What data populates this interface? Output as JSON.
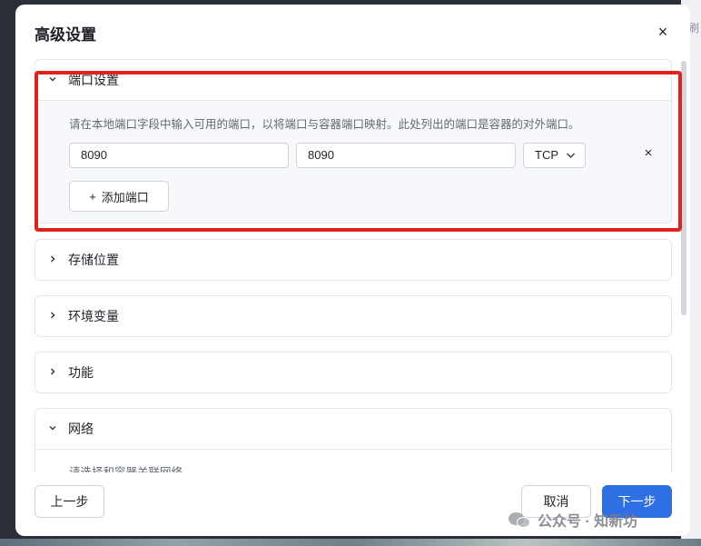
{
  "background": {
    "right_peek_text": "刷"
  },
  "dialog": {
    "title": "高级设置",
    "close_glyph": "×"
  },
  "sections": {
    "ports": {
      "title": "端口设置",
      "expanded": true,
      "description": "请在本地端口字段中输入可用的端口，以将端口与容器端口映射。此处列出的端口是容器的对外端口。",
      "rows": [
        {
          "local_port": "8090",
          "container_port": "8090",
          "protocol": "TCP"
        }
      ],
      "remove_glyph": "×",
      "add_label": "添加端口",
      "add_glyph": "+"
    },
    "storage": {
      "title": "存储位置",
      "expanded": false
    },
    "env": {
      "title": "环境变量",
      "expanded": false
    },
    "features": {
      "title": "功能",
      "expanded": false
    },
    "network": {
      "title": "网络",
      "expanded": true,
      "hint": "请选择和容器关联网络"
    }
  },
  "footer": {
    "prev_label": "上一步",
    "cancel_label": "取消",
    "next_label": "下一步"
  },
  "watermark": {
    "text": "公众号 · 知新坊"
  },
  "colors": {
    "primary": "#2f6fe4",
    "highlight": "#e0241b",
    "border": "#e3e6eb",
    "panel_bg": "#f6f8fb"
  },
  "icons": {
    "chevron_down": "chevron-down-icon",
    "chevron_right": "chevron-right-icon",
    "close": "close-icon",
    "plus": "plus-icon"
  }
}
